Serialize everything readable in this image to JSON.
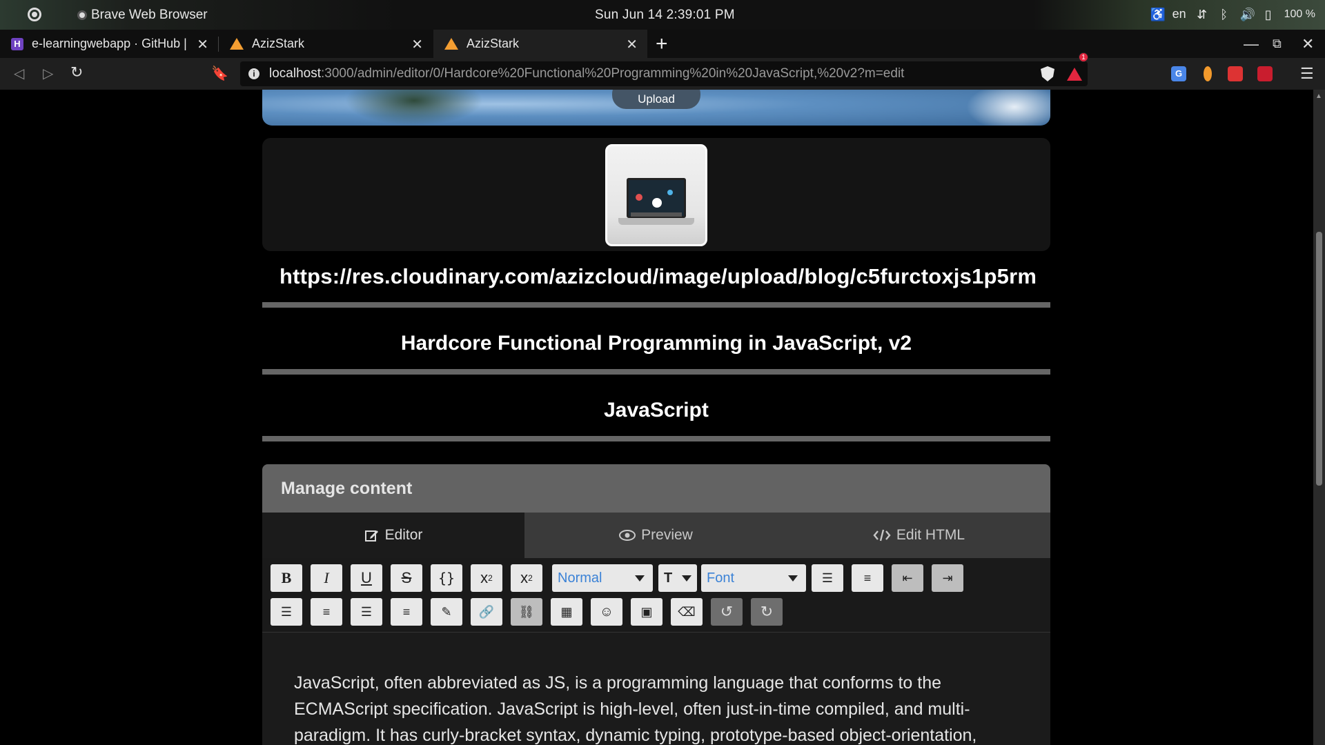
{
  "os_bar": {
    "app_name": "Brave Web Browser",
    "clock": "Sun Jun 14   2:39:01 PM",
    "language": "en",
    "battery": "100 %"
  },
  "tabs": [
    {
      "title": "e-learningwebapp · GitHub | ⠀",
      "active": false
    },
    {
      "title": "AzizStark",
      "active": false
    },
    {
      "title": "AzizStark",
      "active": true
    }
  ],
  "address_bar": {
    "host": "localhost",
    "path": ":3000/admin/editor/0/Hardcore%20Functional%20Programming%20in%20JavaScript,%20v2?m=edit",
    "rewards_badge": "1"
  },
  "page": {
    "upload_label": "Upload",
    "image_url": "https://res.cloudinary.com/azizcloud/image/upload/blog/c5furctoxjs1p5rm",
    "course_title": "Hardcore Functional Programming in JavaScript, v2",
    "category": "JavaScript",
    "manage_heading": "Manage content",
    "editor_tabs": [
      "Editor",
      "Preview",
      "Edit HTML"
    ],
    "toolbar": {
      "format_select": "Normal",
      "font_select": "Font",
      "size_icon": "T"
    },
    "content": "JavaScript, often abbreviated as JS, is a programming language that conforms to the ECMAScript specification. JavaScript is high-level, often just-in-time compiled, and multi-paradigm. It has curly-bracket syntax, dynamic typing, prototype-based object-orientation,"
  },
  "colors": {
    "accent_blue": "#3b82d6",
    "manage_header": "#636363",
    "tab_row": "#3a3a3a"
  }
}
